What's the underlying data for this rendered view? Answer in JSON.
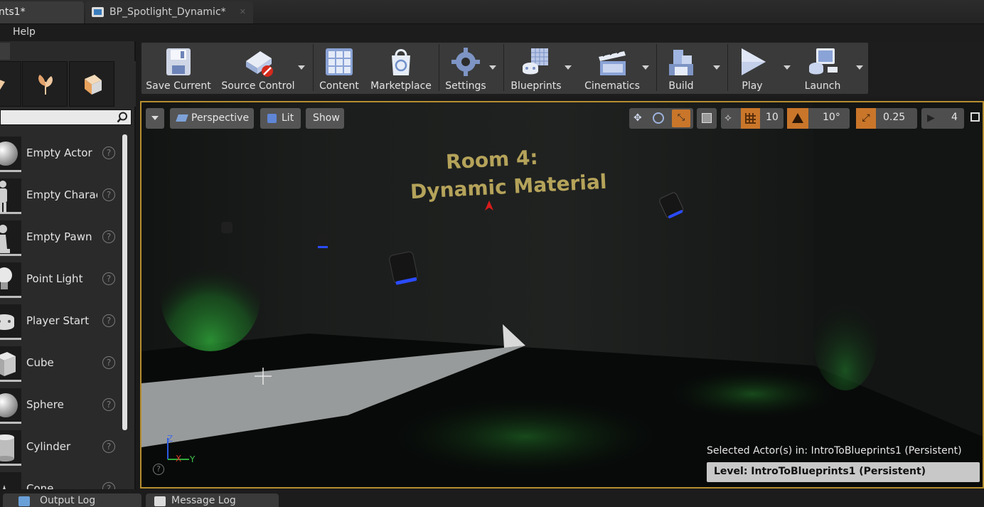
{
  "tabs": [
    {
      "label": "nts1*"
    },
    {
      "label": "BP_Spotlight_Dynamic*"
    }
  ],
  "menu": {
    "help": "Help"
  },
  "modes": {
    "items": [
      {
        "label": "Empty Actor",
        "icon": "sphere-icon"
      },
      {
        "label": "Empty Charac",
        "icon": "character-icon"
      },
      {
        "label": "Empty Pawn",
        "icon": "pawn-icon"
      },
      {
        "label": "Point Light",
        "icon": "light-bulb-icon"
      },
      {
        "label": "Player Start",
        "icon": "gamepad-icon"
      },
      {
        "label": "Cube",
        "icon": "cube-icon"
      },
      {
        "label": "Sphere",
        "icon": "sphere-icon"
      },
      {
        "label": "Cylinder",
        "icon": "cylinder-icon"
      },
      {
        "label": "Cone",
        "icon": "cone-icon"
      }
    ],
    "help_glyph": "?"
  },
  "toolbar": {
    "buttons": [
      {
        "label": "Save Current",
        "icon": "save-icon"
      },
      {
        "label": "Source Control",
        "icon": "source-control-icon"
      },
      {
        "label": "Content",
        "icon": "content-icon"
      },
      {
        "label": "Marketplace",
        "icon": "marketplace-icon"
      },
      {
        "label": "Settings",
        "icon": "settings-icon"
      },
      {
        "label": "Blueprints",
        "icon": "blueprints-icon"
      },
      {
        "label": "Cinematics",
        "icon": "cinematics-icon"
      },
      {
        "label": "Build",
        "icon": "build-icon"
      },
      {
        "label": "Play",
        "icon": "play-icon"
      },
      {
        "label": "Launch",
        "icon": "launch-icon"
      }
    ]
  },
  "viewport": {
    "perspective": "Perspective",
    "lit": "Lit",
    "show": "Show",
    "grid_snap": "10",
    "rotation_snap": "10°",
    "scale_snap": "0.25",
    "camera_speed": "4",
    "scene_title_line1": "Room 4:",
    "scene_title_line2": "Dynamic Material",
    "axis_z": "Z",
    "axis_x": "X",
    "axis_y": "Y",
    "selected_label": "Selected Actor(s) in:  IntroToBlueprints1 (Persistent)",
    "level_label": "Level:  IntroToBlueprints1 (Persistent)"
  },
  "bottom_tabs": [
    {
      "label": "Output Log"
    },
    {
      "label": "Message Log"
    }
  ],
  "colors": {
    "accent": "#b58e2f",
    "toolbar_bg": "#3a3a3a",
    "green_light": "#1f7a2a",
    "blue_spot": "#2a4bff"
  }
}
